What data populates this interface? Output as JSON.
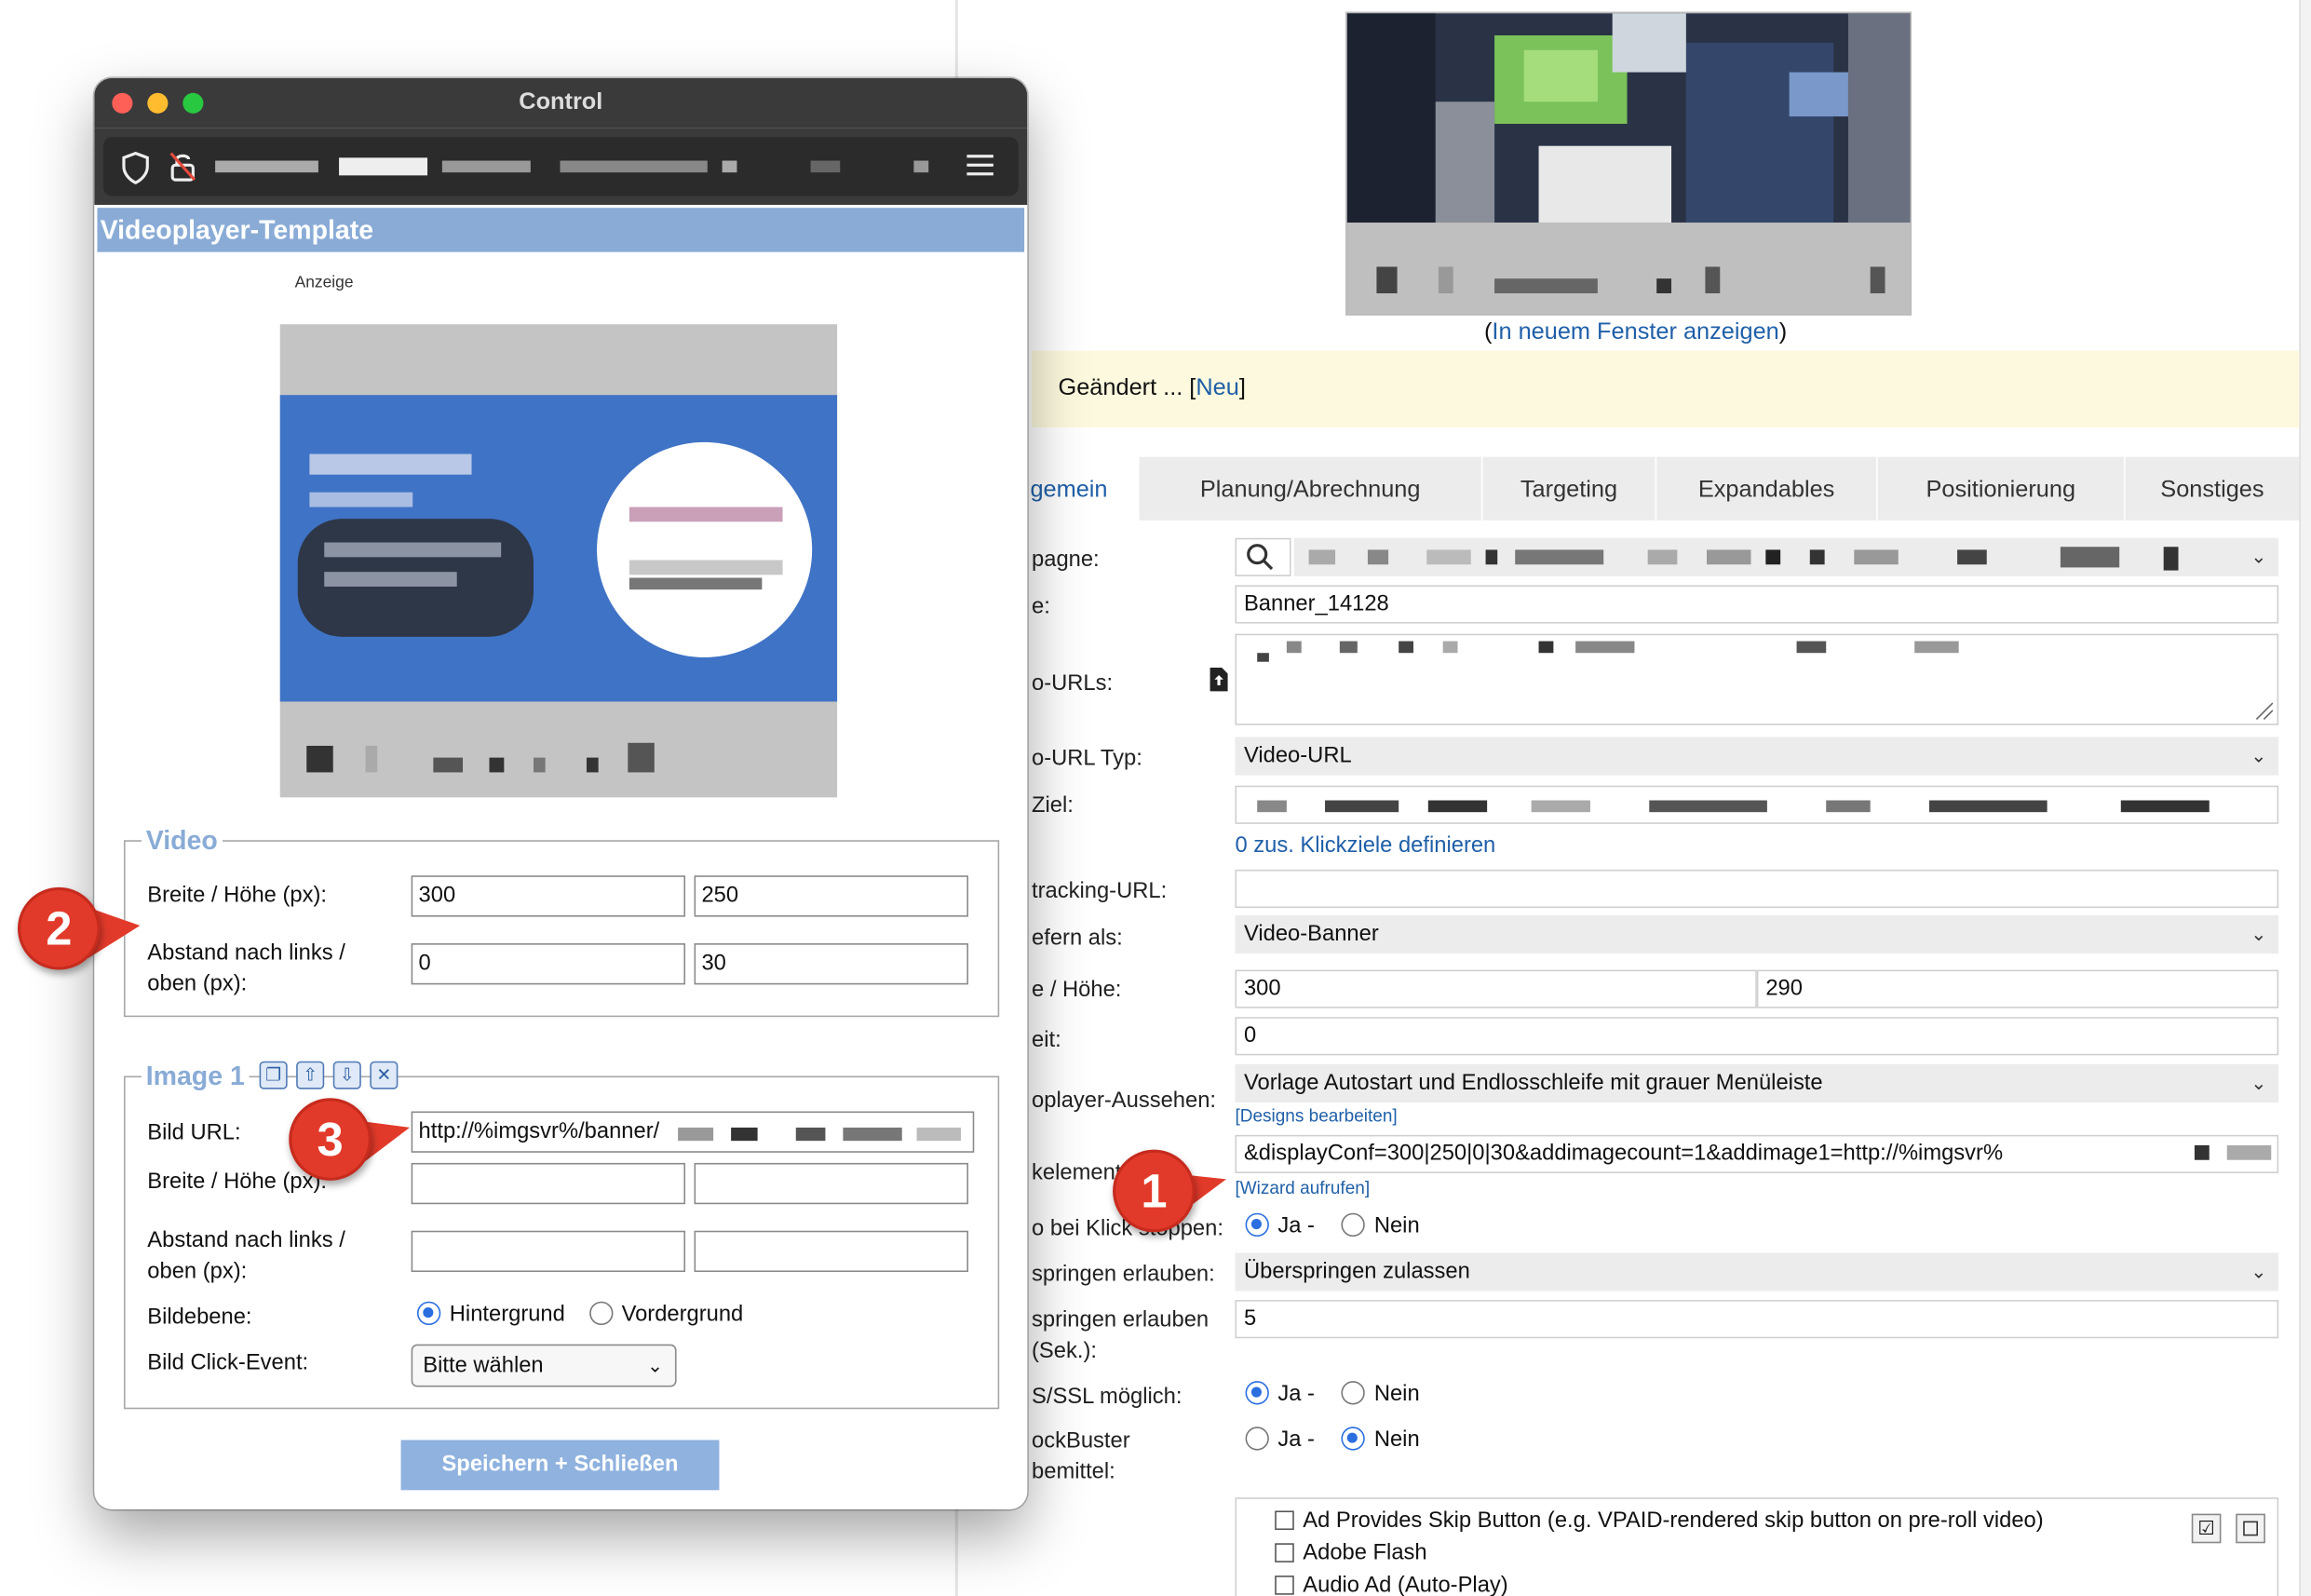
{
  "main": {
    "preview_link": "In neuem Fenster anzeigen",
    "notice": {
      "text": "Geändert ... ",
      "link": "Neu"
    },
    "tabs": [
      {
        "label": "gemein"
      },
      {
        "label": "Planung/Abrechnung"
      },
      {
        "label": "Targeting"
      },
      {
        "label": "Expandables"
      },
      {
        "label": "Positionierung"
      },
      {
        "label": "Sonstiges"
      }
    ],
    "labels": {
      "kampagne": "pagne:",
      "name": "e:",
      "video_urls": "o-URLs:",
      "video_url_typ": "o-URL Typ:",
      "klickziel": "Ziel:",
      "tracking": "tracking-URL:",
      "ausliefern": "efern als:",
      "breite_hoehe": "e / Höhe:",
      "laufzeit": "eit:",
      "player_aussehen": "oplayer-Aussehen:",
      "zusatzelemente": "kelement",
      "klick_stoppen": "o bei Klick stoppen:",
      "ueberspringen": "springen erlauben:",
      "ueberspringen_sek_1": "springen erlauben",
      "ueberspringen_sek_2": "(Sek.):",
      "ssl": "S/SSL möglich:",
      "adblock_1": "ockBuster",
      "adblock_2": "bemittel:"
    },
    "values": {
      "name": "Banner_14128",
      "video_url_typ": "Video-URL",
      "klickziele_link": "0 zus. Klickziele definieren",
      "ausliefern": "Video-Banner",
      "breite": "300",
      "hoehe": "290",
      "laufzeit": "0",
      "player_aussehen": "Vorlage Autostart und Endlosschleife mit grauer Menüleiste",
      "designs_link": "[Designs bearbeiten]",
      "zusatz": "&displayConf=300|250|0|30&addimagecount=1&addimage1=http://%imgsvr%",
      "wizard_link": "[Wizard aufrufen]",
      "ueberspringen": "Überspringen zulassen",
      "ueberspringen_sek": "5"
    },
    "radio": {
      "ja": "Ja -",
      "nein": "Nein"
    },
    "checkboxes": [
      "Ad Provides Skip Button (e.g. VPAID-rendered skip button on pre-roll video)",
      "Adobe Flash",
      "Audio Ad (Auto-Play)"
    ]
  },
  "window": {
    "title": "Control",
    "header": "Videoplayer-Template",
    "ad_label": "Anzeige",
    "video": {
      "legend": "Video",
      "size_label": "Breite / Höhe (px):",
      "width": "300",
      "height": "250",
      "offset_label_1": "Abstand nach links /",
      "offset_label_2": "oben (px):",
      "left": "0",
      "top": "30"
    },
    "image": {
      "legend": "Image 1",
      "url_label": "Bild URL:",
      "url": "http://%imgsvr%/banner/",
      "size_label": "Breite / Höhe (px):",
      "offset_label_1": "Abstand nach links /",
      "offset_label_2": "oben (px):",
      "layer_label": "Bildebene:",
      "layer_bg": "Hintergrund",
      "layer_fg": "Vordergrund",
      "click_label": "Bild Click-Event:",
      "click_value": "Bitte wählen"
    },
    "save_button": "Speichern + Schließen"
  },
  "markers": [
    "1",
    "2",
    "3"
  ],
  "colors": {
    "accent": "#89abd6",
    "link": "#1f5fa8",
    "marker": "#e23a2a"
  }
}
